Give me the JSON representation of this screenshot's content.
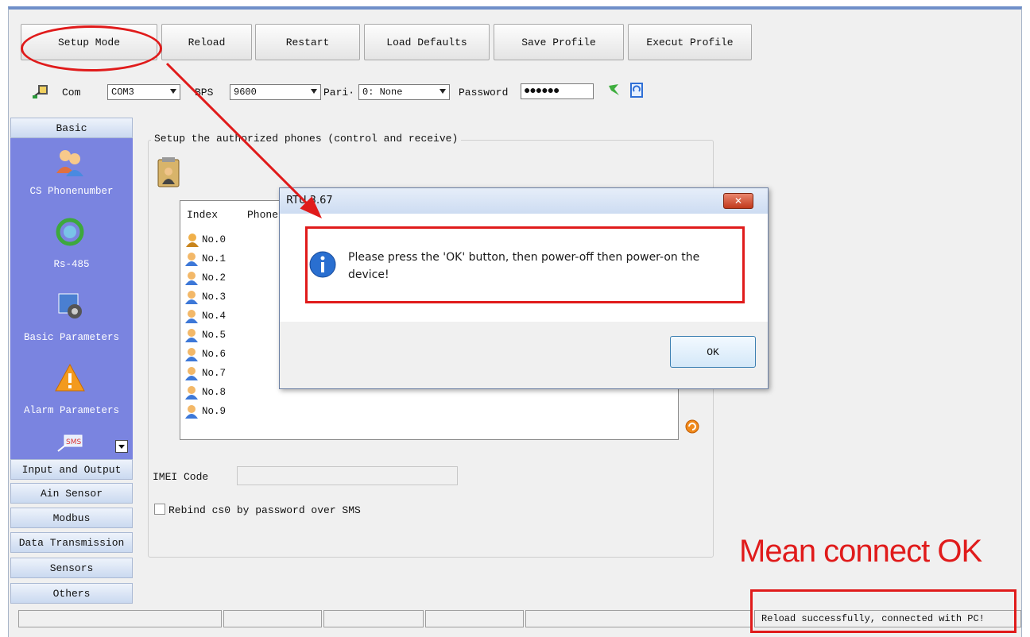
{
  "toolbar": {
    "buttons": [
      "Setup Mode",
      "Reload",
      "Restart",
      "Load Defaults",
      "Save Profile",
      "Execut Profile"
    ]
  },
  "connection": {
    "com_label": "Com",
    "com_value": "COM3",
    "bps_label": "BPS",
    "bps_value": "9600",
    "parity_label": "Pari·",
    "parity_value": "0: None",
    "password_label": "Password",
    "password_value": "●●●●●●"
  },
  "sidebar": {
    "basic_header": "Basic",
    "basic_items": [
      "CS Phonenumber",
      "Rs-485",
      "Basic Parameters",
      "Alarm Parameters"
    ],
    "groups": [
      "Input and Output",
      "Ain Sensor",
      "Modbus",
      "Data Transmission",
      "Sensors",
      "Others"
    ]
  },
  "main": {
    "group_title": "Setup the authorized phones (control and receive)",
    "list_headers": [
      "Index",
      "Phonel"
    ],
    "rows": [
      "No.0",
      "No.1",
      "No.2",
      "No.3",
      "No.4",
      "No.5",
      "No.6",
      "No.7",
      "No.8",
      "No.9"
    ],
    "imei_label": "IMEI Code",
    "imei_value": "",
    "rebind_label": "Rebind cs0 by password over SMS"
  },
  "dialog": {
    "title": "RTU 3.67",
    "message": "Please press the 'OK' button, then power-off then power-on the device!",
    "ok_label": "OK"
  },
  "annotation": {
    "caption": "Mean connect OK"
  },
  "statusbar": {
    "message": "Reload successfully, connected with PC!"
  },
  "colors": {
    "nav_panel": "#7a84e0",
    "annotation_red": "#e01b1b",
    "title_bar": "#6f8fc9"
  }
}
